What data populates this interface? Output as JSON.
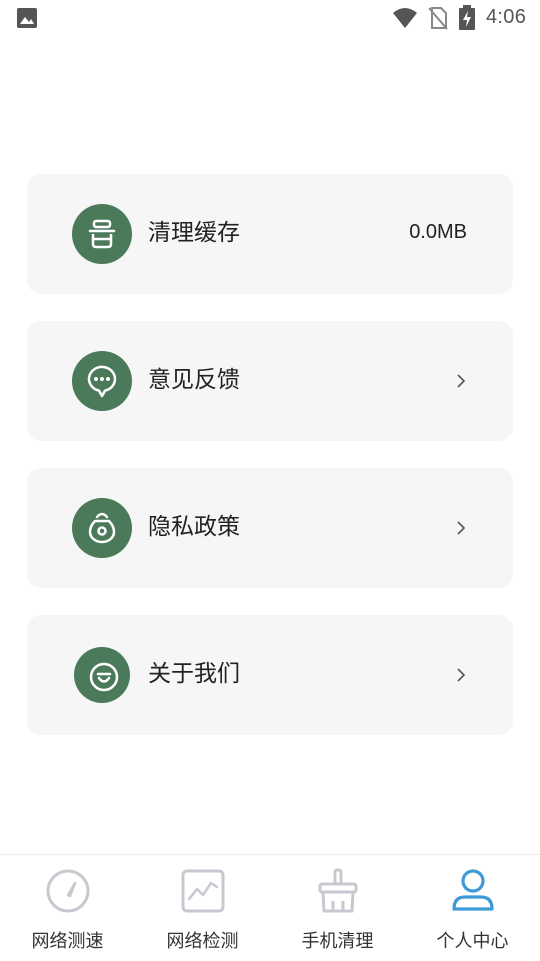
{
  "status_bar": {
    "time": "4:06",
    "icons": [
      "gallery-icon",
      "wifi-icon",
      "no-sim-icon",
      "battery-charging-icon"
    ]
  },
  "menu": [
    {
      "label": "清理缓存",
      "value": "0.0MB",
      "icon": "pot-icon"
    },
    {
      "label": "意见反馈",
      "icon": "chat-bubble-icon"
    },
    {
      "label": "隐私政策",
      "icon": "lock-bag-icon"
    },
    {
      "label": "关于我们",
      "icon": "smiley-icon"
    }
  ],
  "bottom_nav": {
    "items": [
      {
        "label": "网络测速",
        "icon": "speedometer-icon",
        "active": false
      },
      {
        "label": "网络检测",
        "icon": "chart-line-icon",
        "active": false
      },
      {
        "label": "手机清理",
        "icon": "broom-icon",
        "active": false
      },
      {
        "label": "个人中心",
        "icon": "person-icon",
        "active": true
      }
    ],
    "active_color": "#3d9ad6",
    "inactive_color": "#c8c8d0"
  },
  "colors": {
    "icon_circle": "#4a7a5a",
    "card_bg": "#f6f6f6"
  }
}
